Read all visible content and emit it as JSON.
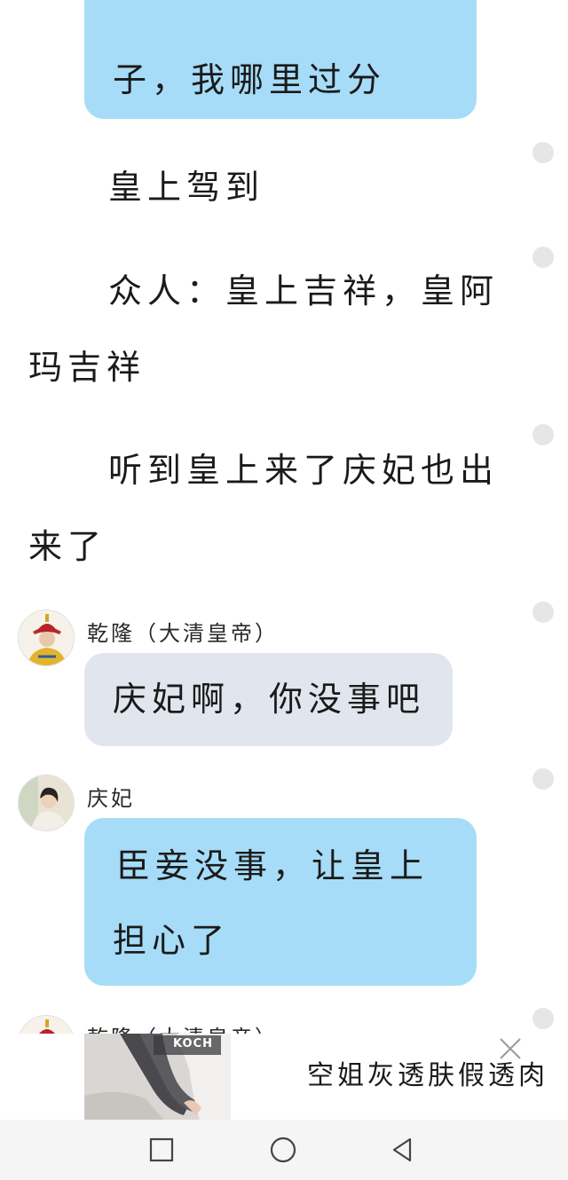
{
  "chat": {
    "top_bubble_text": "子，我哪里过分",
    "narration_1": "皇上驾到",
    "narration_2_line1": "众人：皇上吉祥，皇阿",
    "narration_2_line2": "玛吉祥",
    "narration_3_line1": "听到皇上来了庆妃也出",
    "narration_3_line2": "来了",
    "msg1": {
      "sender": "乾隆（大清皇帝）",
      "text": "庆妃啊，你没事吧"
    },
    "msg2": {
      "sender": "庆妃",
      "text_line1": "臣妾没事，让皇上",
      "text_line2": "担心了"
    },
    "msg3": {
      "sender": "乾隆（大清皇帝）"
    }
  },
  "ad": {
    "text": "空姐灰透肤假透肉",
    "image_text": "KOCH"
  },
  "colors": {
    "blue_bubble": "#a6dcf7",
    "gray_bubble": "#e1e6ee",
    "dot": "#e6e6e6",
    "navbar": "#f5f5f5"
  },
  "icons": [
    "close-icon",
    "recent-apps-icon",
    "home-icon",
    "back-icon"
  ]
}
